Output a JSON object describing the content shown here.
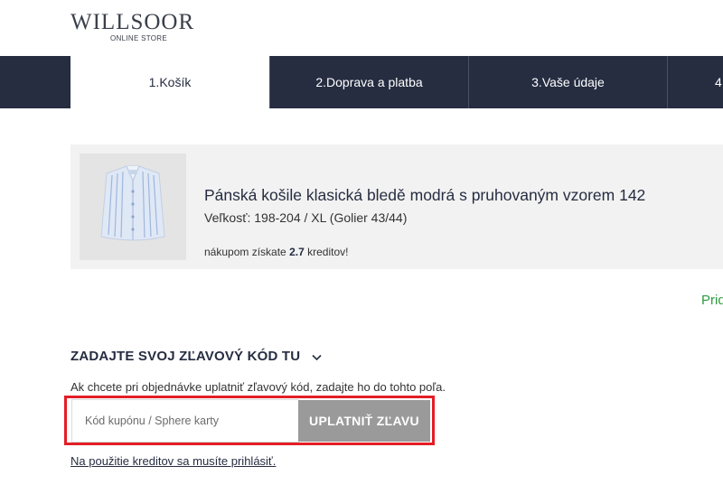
{
  "header": {
    "logo_main": "WILLSOOR",
    "logo_sub": "ONLINE STORE"
  },
  "steps": [
    {
      "label": "1.Košík",
      "active": true
    },
    {
      "label": "2.Doprava a platba",
      "active": false
    },
    {
      "label": "3.Vaše údaje",
      "active": false
    },
    {
      "label": "4",
      "active": false
    }
  ],
  "cart_item": {
    "title": "Pánská košile klasická bledě modrá s pruhovaným vzorem 142",
    "size": "Veľkosť: 198-204 / XL (Golier 43/44)",
    "credit_prefix": "nákupom získate",
    "credit_value": "2.7",
    "credit_suffix": "kreditov!",
    "image_icon": "shirt-image"
  },
  "right_link": "Prid",
  "discount": {
    "heading": "ZADAJTE SVOJ ZĽAVOVÝ KÓD TU",
    "description": "Ak chcete pri objednávke uplatniť zľavový kód, zadajte ho do tohto poľa.",
    "input_value": "",
    "input_placeholder": "Kód kupónu / Sphere karty",
    "apply_label": "UPLATNIŤ ZĽAVU",
    "login_link": "Na použitie kreditov sa musíte prihlásiť."
  },
  "colors": {
    "nav_bg": "#262d41",
    "highlight": "#e31e26",
    "button_bg": "#9a9a9a",
    "link_green": "#2e9c3f"
  }
}
